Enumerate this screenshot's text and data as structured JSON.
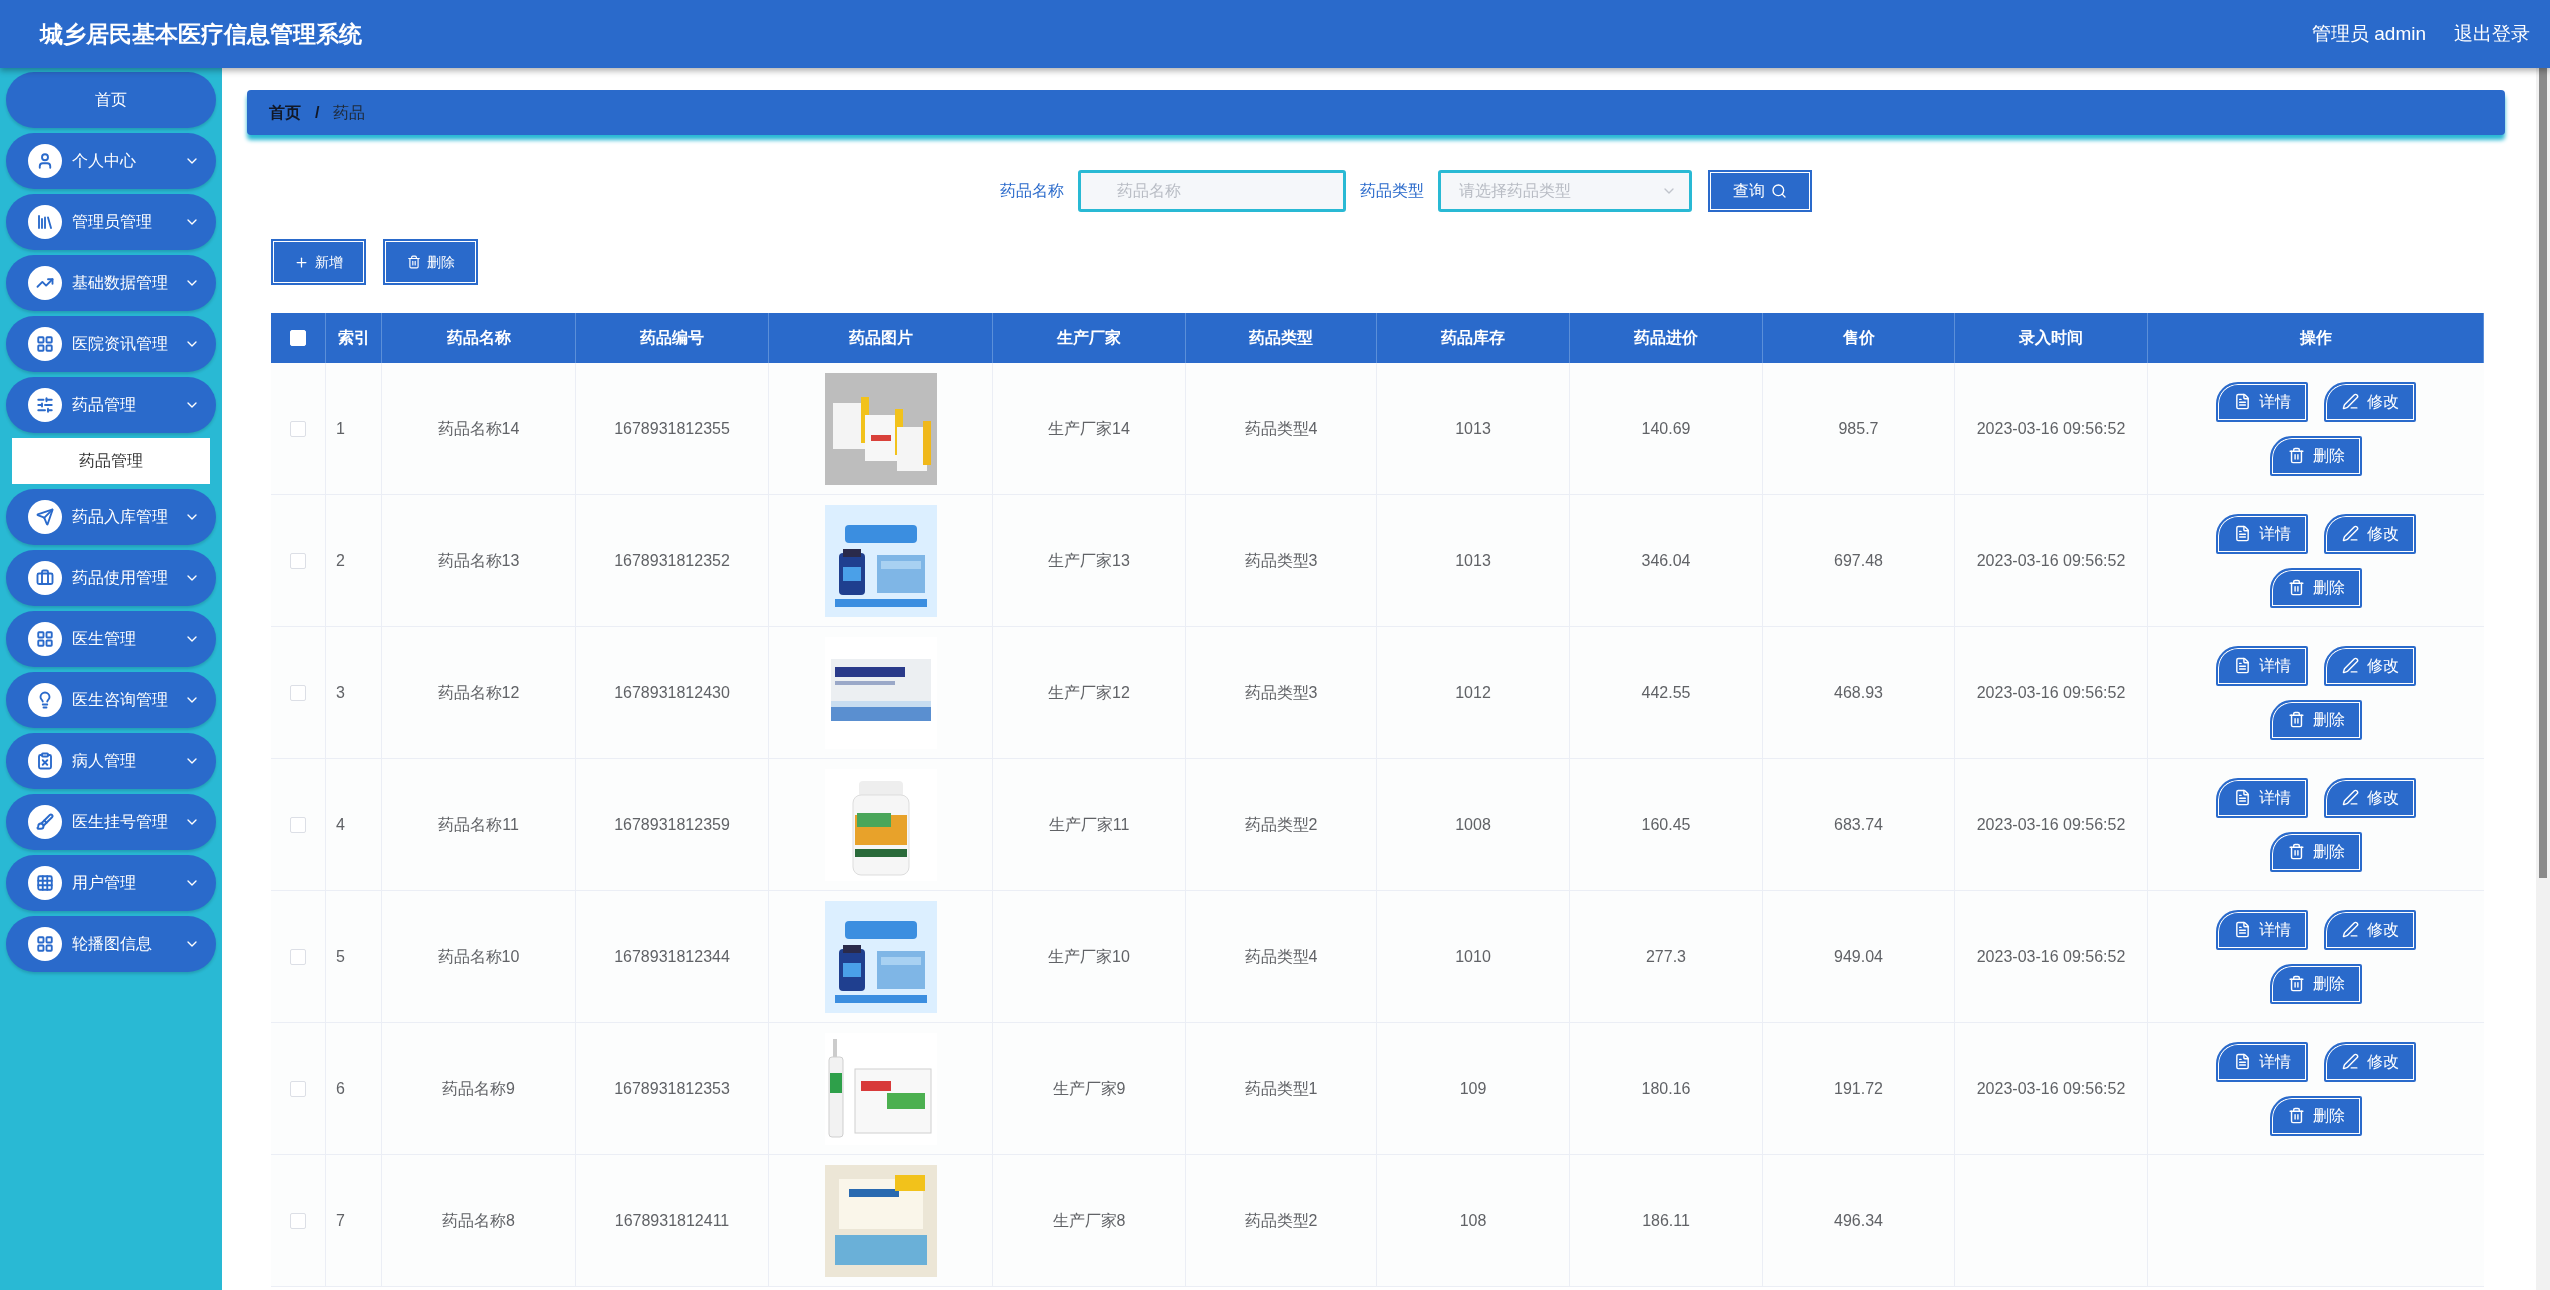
{
  "header": {
    "title": "城乡居民基本医疗信息管理系统",
    "user": "管理员 admin",
    "logout": "退出登录"
  },
  "sidebar": {
    "items": [
      {
        "kind": "home",
        "label": "首页"
      },
      {
        "kind": "menu",
        "label": "个人中心"
      },
      {
        "kind": "menu",
        "label": "管理员管理"
      },
      {
        "kind": "menu",
        "label": "基础数据管理"
      },
      {
        "kind": "menu",
        "label": "医院资讯管理"
      },
      {
        "kind": "menu",
        "label": "药品管理",
        "children": [
          {
            "label": "药品管理",
            "selected": true
          }
        ]
      },
      {
        "kind": "menu",
        "label": "药品入库管理"
      },
      {
        "kind": "menu",
        "label": "药品使用管理"
      },
      {
        "kind": "menu",
        "label": "医生管理"
      },
      {
        "kind": "menu",
        "label": "医生咨询管理"
      },
      {
        "kind": "menu",
        "label": "病人管理"
      },
      {
        "kind": "menu",
        "label": "医生挂号管理"
      },
      {
        "kind": "menu",
        "label": "用户管理"
      },
      {
        "kind": "menu",
        "label": "轮播图信息"
      }
    ]
  },
  "breadcrumb": [
    {
      "kind": "link",
      "label": "首页"
    },
    {
      "kind": "separator",
      "label": "/"
    },
    {
      "kind": "current",
      "label": "药品"
    }
  ],
  "search": {
    "fields": [
      {
        "kind": "text",
        "label": "药品名称",
        "placeholder": "药品名称"
      },
      {
        "kind": "select",
        "label": "药品类型",
        "placeholder": "请选择药品类型"
      }
    ],
    "button": "查询"
  },
  "actions": [
    {
      "kind": "add",
      "label": "新增"
    },
    {
      "kind": "delete",
      "label": "删除"
    }
  ],
  "table": {
    "select_all": {
      "checked": false
    },
    "columns": [
      "索引",
      "药品名称",
      "药品编号",
      "药品图片",
      "生产厂家",
      "药品类型",
      "药品库存",
      "药品进价",
      "售价",
      "录入时间",
      "操作"
    ],
    "rows": [
      {
        "checked": false,
        "index": "1",
        "name": "药品名称14",
        "code": "1678931812355",
        "maker": "生产厂家14",
        "type": "药品类型4",
        "stock": "1013",
        "cost": "140.69",
        "price": "985.7",
        "time": "2023-03-16 09:56:52",
        "actions": [
          "详情",
          "修改",
          "删除"
        ]
      },
      {
        "checked": false,
        "index": "2",
        "name": "药品名称13",
        "code": "1678931812352",
        "maker": "生产厂家13",
        "type": "药品类型3",
        "stock": "1013",
        "cost": "346.04",
        "price": "697.48",
        "time": "2023-03-16 09:56:52",
        "actions": [
          "详情",
          "修改",
          "删除"
        ]
      },
      {
        "checked": false,
        "index": "3",
        "name": "药品名称12",
        "code": "1678931812430",
        "maker": "生产厂家12",
        "type": "药品类型3",
        "stock": "1012",
        "cost": "442.55",
        "price": "468.93",
        "time": "2023-03-16 09:56:52",
        "actions": [
          "详情",
          "修改",
          "删除"
        ]
      },
      {
        "checked": false,
        "index": "4",
        "name": "药品名称11",
        "code": "1678931812359",
        "maker": "生产厂家11",
        "type": "药品类型2",
        "stock": "1008",
        "cost": "160.45",
        "price": "683.74",
        "time": "2023-03-16 09:56:52",
        "actions": [
          "详情",
          "修改",
          "删除"
        ]
      },
      {
        "checked": false,
        "index": "5",
        "name": "药品名称10",
        "code": "1678931812344",
        "maker": "生产厂家10",
        "type": "药品类型4",
        "stock": "1010",
        "cost": "277.3",
        "price": "949.04",
        "time": "2023-03-16 09:56:52",
        "actions": [
          "详情",
          "修改",
          "删除"
        ]
      },
      {
        "checked": false,
        "index": "6",
        "name": "药品名称9",
        "code": "1678931812353",
        "maker": "生产厂家9",
        "type": "药品类型1",
        "stock": "109",
        "cost": "180.16",
        "price": "191.72",
        "time": "2023-03-16 09:56:52",
        "actions": [
          "详情",
          "修改",
          "删除"
        ]
      },
      {
        "checked": false,
        "index": "7",
        "name": "药品名称8",
        "code": "1678931812411",
        "maker": "生产厂家8",
        "type": "药品类型2",
        "stock": "108",
        "cost": "186.11",
        "price": "496.34"
      }
    ]
  }
}
